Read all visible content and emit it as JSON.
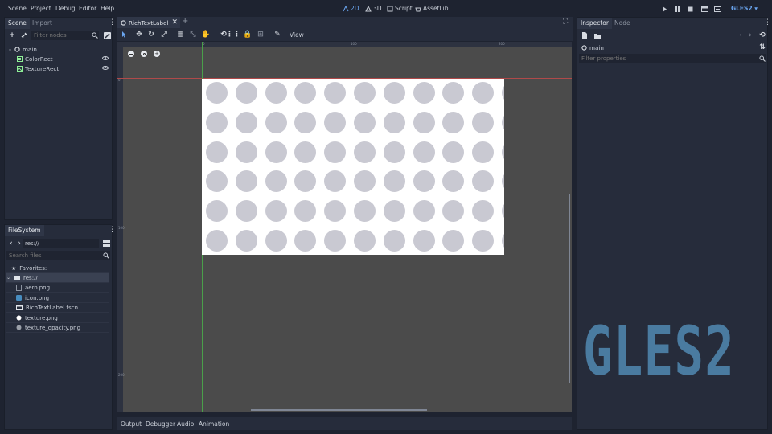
{
  "menubar": {
    "items": [
      "Scene",
      "Project",
      "Debug",
      "Editor",
      "Help"
    ],
    "modes": [
      "2D",
      "3D",
      "Script",
      "AssetLib"
    ],
    "renderer": "GLES2 ▾"
  },
  "scene_dock": {
    "tabs": [
      "Scene",
      "Import"
    ],
    "filter_placeholder": "Filter nodes",
    "tree": [
      {
        "label": "main",
        "icon": "node-circle-icon"
      },
      {
        "label": "ColorRect",
        "icon": "color-rect-icon"
      },
      {
        "label": "TextureRect",
        "icon": "texture-rect-icon"
      }
    ]
  },
  "filesystem_dock": {
    "tab": "FileSystem",
    "path": "res://",
    "search_placeholder": "Search files",
    "items": [
      {
        "label": "Favorites:",
        "icon": "star-icon"
      },
      {
        "label": "res://",
        "icon": "folder-icon"
      },
      {
        "label": "aero.png",
        "icon": "image-file-icon"
      },
      {
        "label": "icon.png",
        "icon": "godot-icon"
      },
      {
        "label": "RichTextLabel.tscn",
        "icon": "scene-file-icon"
      },
      {
        "label": "texture.png",
        "icon": "white-dot-icon"
      },
      {
        "label": "texture_opacity.png",
        "icon": "gray-dot-icon"
      }
    ]
  },
  "editor": {
    "scene_tab": "RichTextLabel",
    "toolbar_view": "View",
    "ruler_labels": [
      "0",
      "100",
      "200",
      "0",
      "100",
      "200"
    ]
  },
  "bottom_panel": {
    "tabs": [
      "Output",
      "Debugger",
      "Audio",
      "Animation"
    ]
  },
  "inspector_dock": {
    "tabs": [
      "Inspector",
      "Node"
    ],
    "object": "main",
    "filter_placeholder": "Filter properties"
  },
  "watermark": "GLES2",
  "colors": {
    "accent": "#6aa5f0",
    "viewport": "#4b4b4b",
    "dot": "#c9c9d2",
    "logo": "#4a7ba0"
  }
}
